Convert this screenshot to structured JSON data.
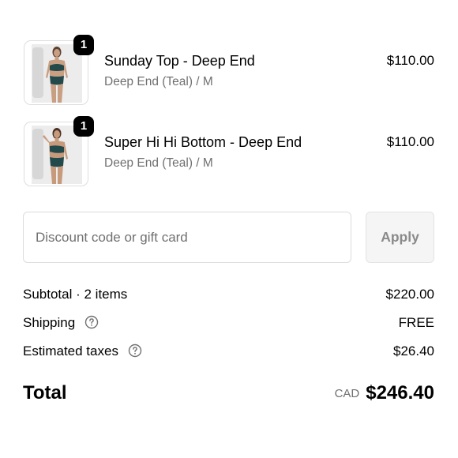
{
  "line_items": [
    {
      "quantity": "1",
      "title": "Sunday Top - Deep End",
      "variant": "Deep End (Teal) / M",
      "price": "$110.00"
    },
    {
      "quantity": "1",
      "title": "Super Hi Hi Bottom - Deep End",
      "variant": "Deep End (Teal) / M",
      "price": "$110.00"
    }
  ],
  "discount": {
    "placeholder": "Discount code or gift card",
    "value": "",
    "apply_label": "Apply"
  },
  "summary": {
    "subtotal_label": "Subtotal · 2 items",
    "subtotal_value": "$220.00",
    "shipping_label": "Shipping",
    "shipping_value": "FREE",
    "taxes_label": "Estimated taxes",
    "taxes_value": "$26.40"
  },
  "total": {
    "label": "Total",
    "currency": "CAD",
    "amount": "$246.40"
  },
  "icons": {
    "help": "question-circle-icon",
    "badge": "quantity-badge"
  },
  "colors": {
    "badge_bg": "#000000",
    "muted_text": "#707070",
    "swimwear_teal": "#23494a"
  }
}
